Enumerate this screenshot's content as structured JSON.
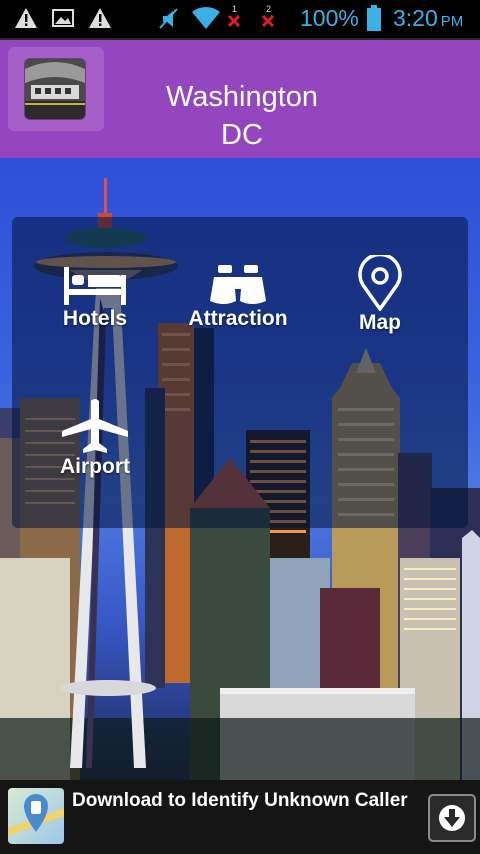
{
  "status_bar": {
    "battery_percent": "100%",
    "time": "3:20",
    "ampm": "PM",
    "sim1": "1",
    "sim2": "2",
    "icons": [
      "warning-icon",
      "image-icon",
      "warning-icon",
      "mute-icon",
      "wifi-icon",
      "no-signal-icon",
      "no-signal-icon",
      "battery-icon"
    ]
  },
  "header": {
    "title": "Washington\nDC"
  },
  "menu": {
    "items": [
      {
        "label": "Hotels",
        "icon": "bed-icon"
      },
      {
        "label": "Attraction",
        "icon": "binoculars-icon"
      },
      {
        "label": "Map",
        "icon": "map-pin-icon"
      },
      {
        "label": "Airport",
        "icon": "airplane-icon"
      }
    ]
  },
  "ad": {
    "text": "Download to Identify Unknown Caller",
    "icon": "caller-id-app-icon",
    "action_icon": "download-icon"
  },
  "colors": {
    "header_bg": "#9346bd",
    "status_accent": "#3ab0e6"
  }
}
